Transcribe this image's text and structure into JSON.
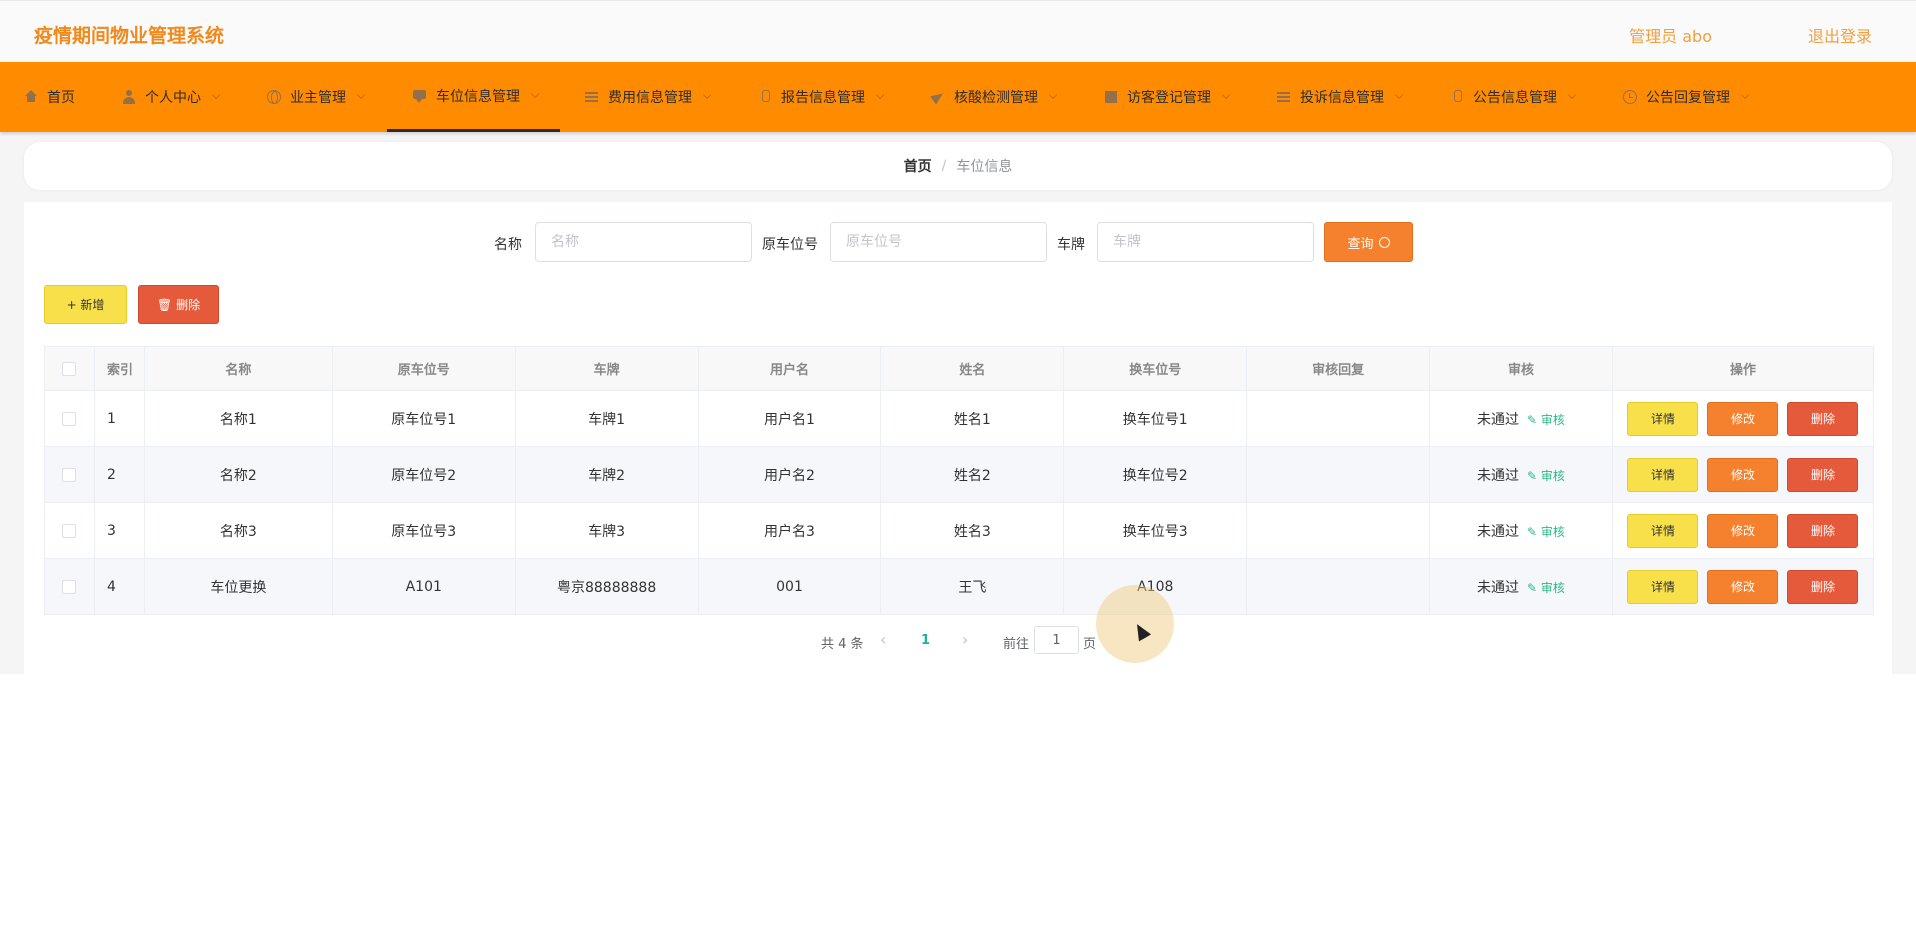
{
  "header": {
    "app_title": "疫情期间物业管理系统",
    "user_label": "管理员 abo",
    "logout_label": "退出登录"
  },
  "nav": {
    "items": [
      {
        "label": "首页",
        "icon": "home-icon"
      },
      {
        "label": "个人中心",
        "icon": "user-icon"
      },
      {
        "label": "业主管理",
        "icon": "globe-icon"
      },
      {
        "label": "车位信息管理",
        "icon": "chat-icon"
      },
      {
        "label": "费用信息管理",
        "icon": "list-icon"
      },
      {
        "label": "报告信息管理",
        "icon": "mic-icon"
      },
      {
        "label": "核酸检测管理",
        "icon": "plane-icon"
      },
      {
        "label": "访客登记管理",
        "icon": "book-icon"
      },
      {
        "label": "投诉信息管理",
        "icon": "list-icon"
      },
      {
        "label": "公告信息管理",
        "icon": "mic-icon"
      },
      {
        "label": "公告回复管理",
        "icon": "clock-icon"
      }
    ],
    "active_index": 3
  },
  "breadcrumb": {
    "home": "首页",
    "separator": "/",
    "current": "车位信息"
  },
  "search": {
    "name_label": "名称",
    "name_placeholder": "名称",
    "name_value": "",
    "orig_spot_label": "原车位号",
    "orig_spot_placeholder": "原车位号",
    "orig_spot_value": "",
    "plate_label": "车牌",
    "plate_placeholder": "车牌",
    "plate_value": "",
    "query_label": "查询"
  },
  "actions": {
    "add_label": "+ 新增",
    "delete_label": "删除"
  },
  "table": {
    "headers": [
      "索引",
      "名称",
      "原车位号",
      "车牌",
      "用户名",
      "姓名",
      "换车位号",
      "审核回复",
      "审核",
      "操作"
    ],
    "rows": [
      {
        "index": "1",
        "name": "名称1",
        "orig_spot": "原车位号1",
        "plate": "车牌1",
        "username": "用户名1",
        "realname": "姓名1",
        "new_spot": "换车位号1",
        "reply": "",
        "status": "未通过",
        "audit_link": "审核"
      },
      {
        "index": "2",
        "name": "名称2",
        "orig_spot": "原车位号2",
        "plate": "车牌2",
        "username": "用户名2",
        "realname": "姓名2",
        "new_spot": "换车位号2",
        "reply": "",
        "status": "未通过",
        "audit_link": "审核"
      },
      {
        "index": "3",
        "name": "名称3",
        "orig_spot": "原车位号3",
        "plate": "车牌3",
        "username": "用户名3",
        "realname": "姓名3",
        "new_spot": "换车位号3",
        "reply": "",
        "status": "未通过",
        "audit_link": "审核"
      },
      {
        "index": "4",
        "name": "车位更换",
        "orig_spot": "A101",
        "plate": "粤京88888888",
        "username": "001",
        "realname": "王飞",
        "new_spot": "A108",
        "reply": "",
        "status": "未通过",
        "audit_link": "审核"
      }
    ],
    "op_detail": "详情",
    "op_edit": "修改",
    "op_delete": "删除"
  },
  "pagination": {
    "total": "共 4 条",
    "current_page": "1",
    "goto_label": "前往",
    "goto_value": "1",
    "page_suffix": "页"
  },
  "colors": {
    "navbar": "#ff8c00",
    "title": "#f0891e",
    "add_button": "#f7e04a",
    "delete_button": "#e65a3c",
    "edit_button": "#f5812f",
    "audit_link": "#2fb888",
    "page_active": "#1fb19e"
  }
}
